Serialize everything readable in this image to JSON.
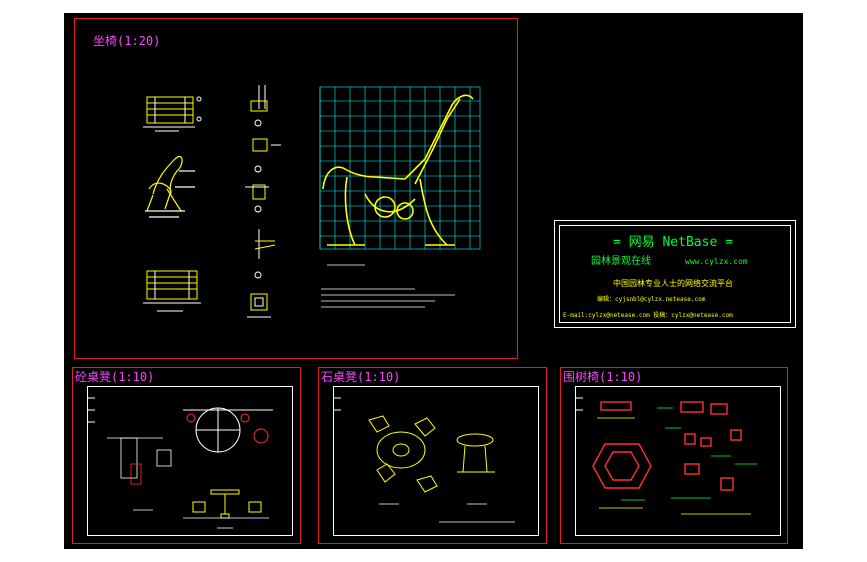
{
  "colors": {
    "background": "#000000",
    "frame": "#e0201c",
    "title": "#ff40ff",
    "drawing_primary": "#ffff00",
    "drawing_grid": "#00ffff",
    "drawing_secondary": "#ff3030",
    "logo_text": "#00ff33"
  },
  "panels": {
    "main": {
      "title": "坐椅(1:20)"
    },
    "bottom_left": {
      "title": "砼桌凳(1:10)"
    },
    "bottom_mid": {
      "title": "石桌凳(1:10)"
    },
    "bottom_right": {
      "title": "围树椅(1:10)"
    }
  },
  "logo": {
    "headline": "= 网易 NetBase =",
    "site_name": "园林景观在线",
    "site_url": "www.cylzx.com",
    "tagline": "中国园林专业人士的网络交流平台",
    "editor_line": "编辑：cyjsnbl@cylzx.netease.com",
    "contact_line": "E-mail:cylzx@netease.com    投稿：cylzx@netease.com"
  }
}
